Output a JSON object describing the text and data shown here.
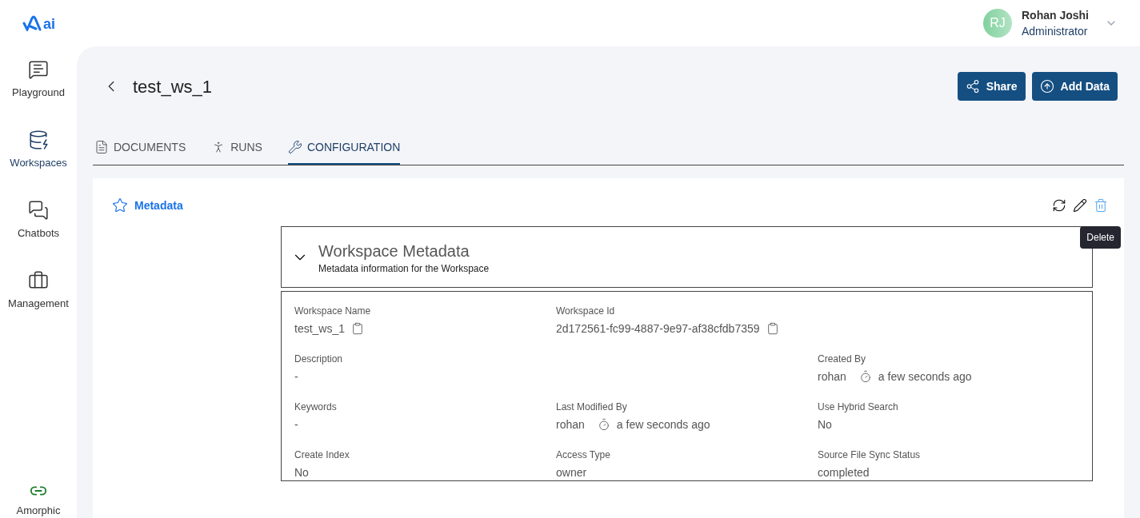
{
  "logo": {
    "text": "ai"
  },
  "user": {
    "initials": "RJ",
    "name": "Rohan Joshi",
    "role": "Administrator"
  },
  "sidebar": {
    "items": [
      {
        "label": "Playground",
        "kind": "chat",
        "selected": false
      },
      {
        "label": "Workspaces",
        "kind": "cloud",
        "selected": true
      },
      {
        "label": "Chatbots",
        "kind": "bots",
        "selected": false
      },
      {
        "label": "Management",
        "kind": "bag",
        "selected": false
      }
    ],
    "footer": {
      "label": "Amorphic"
    }
  },
  "page": {
    "title": "test_ws_1",
    "buttons": [
      {
        "label": "Share",
        "kind": "share"
      },
      {
        "label": "Add Data",
        "kind": "upload"
      }
    ]
  },
  "tabs": [
    {
      "label": "DOCUMENTS",
      "kind": "doc",
      "selected": false
    },
    {
      "label": "RUNS",
      "kind": "run",
      "selected": false
    },
    {
      "label": "CONFIGURATION",
      "kind": "tools",
      "selected": true
    }
  ],
  "section": {
    "title": "Metadata",
    "tooltip": "Delete"
  },
  "accordion": {
    "title": "Workspace Metadata",
    "subtitle": "Metadata information for the Workspace",
    "expanded": true
  },
  "rows": [
    [
      {
        "kind": "copy",
        "label": "Workspace Name",
        "value": "test_ws_1"
      },
      {
        "kind": "copy",
        "label": "Workspace Id",
        "value": "2d172561-fc99-4887-9e97-af38cfdb7359"
      },
      {
        "kind": "blank"
      }
    ],
    [
      {
        "kind": "plain",
        "label": "Description",
        "value": "-"
      },
      {
        "kind": "blank"
      },
      {
        "kind": "time",
        "label": "Created By",
        "value": "rohan",
        "time": "a few seconds ago"
      }
    ],
    [
      {
        "kind": "plain",
        "label": "Keywords",
        "value": "-"
      },
      {
        "kind": "time",
        "label": "Last Modified By",
        "value": "rohan",
        "time": "a few seconds ago"
      },
      {
        "kind": "plain",
        "label": "Use Hybrid Search",
        "value": "No"
      }
    ],
    [
      {
        "kind": "plain",
        "label": "Create Index",
        "value": "No"
      },
      {
        "kind": "plain",
        "label": "Access Type",
        "value": "owner"
      },
      {
        "kind": "plain",
        "label": "Source File Sync Status",
        "value": "completed"
      }
    ]
  ]
}
